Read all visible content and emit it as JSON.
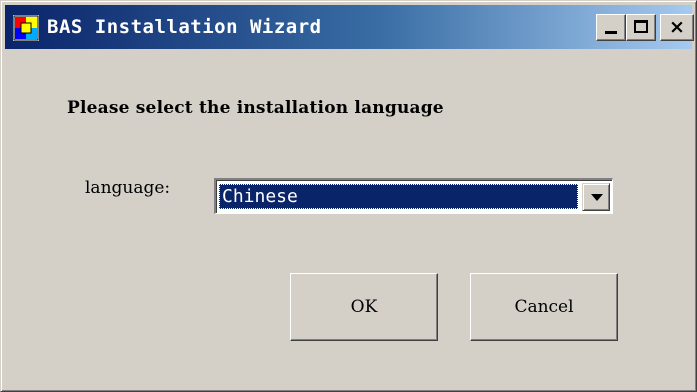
{
  "window": {
    "title": "BAS Installation Wizard",
    "icon": "app-window-icon",
    "controls": {
      "minimize": "minimize-icon",
      "maximize": "maximize-icon",
      "close_glyph": "×"
    }
  },
  "dialog": {
    "prompt": "Please select the installation language",
    "language_label": "language:",
    "language_selected": "Chinese",
    "ok_label": "OK",
    "cancel_label": "Cancel"
  },
  "colors": {
    "titlebar_start": "#0a246a",
    "titlebar_end": "#a6caf0",
    "face": "#d4d0c8",
    "selection": "#0a246a"
  }
}
